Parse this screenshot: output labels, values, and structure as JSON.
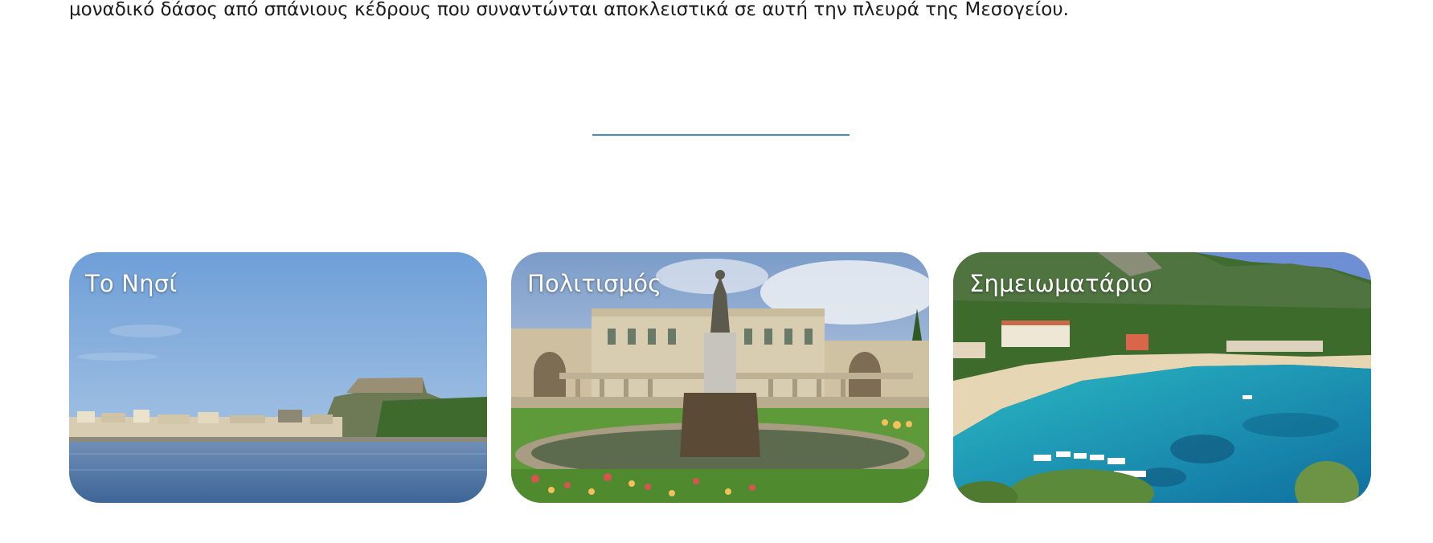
{
  "intro": {
    "text": "μοναδικό δάσος από σπάνιους κέδρους που συναντώνται αποκλειστικά σε αυτή την πλευρά της Μεσογείου."
  },
  "cards": [
    {
      "title": "Το Νησί"
    },
    {
      "title": "Πολιτισμός"
    },
    {
      "title": "Σημειωματάριο"
    }
  ],
  "colors": {
    "divider": "#4a8bb8",
    "card_title": "#ffffff"
  }
}
